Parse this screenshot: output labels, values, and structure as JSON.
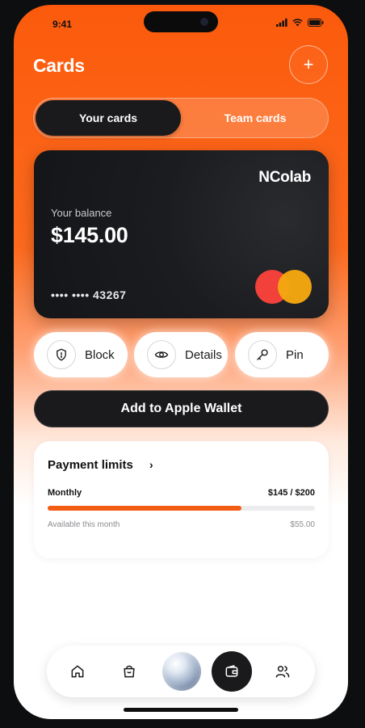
{
  "status_bar": {
    "time": "9:41"
  },
  "header": {
    "title": "Cards",
    "add_label": "+"
  },
  "tabs": {
    "active": "Your cards",
    "inactive": "Team cards"
  },
  "card": {
    "brand": "NColab",
    "balance_label": "Your balance",
    "balance": "$145.00",
    "number": "•••• •••• 43267",
    "network_icon": "mastercard-logo"
  },
  "actions": [
    {
      "label": "Block",
      "icon": "shield-alert-icon"
    },
    {
      "label": "Details",
      "icon": "eye-icon"
    },
    {
      "label": "Pin",
      "icon": "key-icon"
    }
  ],
  "wallet_button": "Add to Apple Wallet",
  "limits": {
    "title": "Payment limits",
    "chevron": "›",
    "period": "Monthly",
    "amount": "$145 / $200",
    "progress": 0.725,
    "available_label": "Available this month",
    "available": "$55.00"
  },
  "nav": [
    "home-icon",
    "bag-icon",
    "orb",
    "wallet-icon",
    "people-icon"
  ],
  "colors": {
    "accent": "#f25c13",
    "dark": "#1a1a1c",
    "card_red": "#f2413b",
    "card_yellow": "#f4a710"
  }
}
